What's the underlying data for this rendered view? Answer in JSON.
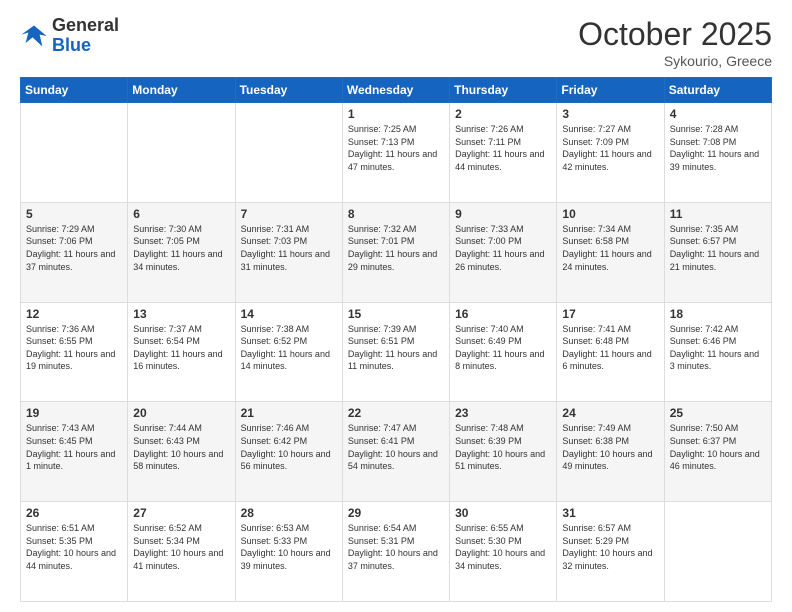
{
  "header": {
    "logo_general": "General",
    "logo_blue": "Blue",
    "month_title": "October 2025",
    "location": "Sykourio, Greece"
  },
  "days_of_week": [
    "Sunday",
    "Monday",
    "Tuesday",
    "Wednesday",
    "Thursday",
    "Friday",
    "Saturday"
  ],
  "weeks": [
    [
      {
        "day": "",
        "sunrise": "",
        "sunset": "",
        "daylight": ""
      },
      {
        "day": "",
        "sunrise": "",
        "sunset": "",
        "daylight": ""
      },
      {
        "day": "",
        "sunrise": "",
        "sunset": "",
        "daylight": ""
      },
      {
        "day": "1",
        "sunrise": "Sunrise: 7:25 AM",
        "sunset": "Sunset: 7:13 PM",
        "daylight": "Daylight: 11 hours and 47 minutes."
      },
      {
        "day": "2",
        "sunrise": "Sunrise: 7:26 AM",
        "sunset": "Sunset: 7:11 PM",
        "daylight": "Daylight: 11 hours and 44 minutes."
      },
      {
        "day": "3",
        "sunrise": "Sunrise: 7:27 AM",
        "sunset": "Sunset: 7:09 PM",
        "daylight": "Daylight: 11 hours and 42 minutes."
      },
      {
        "day": "4",
        "sunrise": "Sunrise: 7:28 AM",
        "sunset": "Sunset: 7:08 PM",
        "daylight": "Daylight: 11 hours and 39 minutes."
      }
    ],
    [
      {
        "day": "5",
        "sunrise": "Sunrise: 7:29 AM",
        "sunset": "Sunset: 7:06 PM",
        "daylight": "Daylight: 11 hours and 37 minutes."
      },
      {
        "day": "6",
        "sunrise": "Sunrise: 7:30 AM",
        "sunset": "Sunset: 7:05 PM",
        "daylight": "Daylight: 11 hours and 34 minutes."
      },
      {
        "day": "7",
        "sunrise": "Sunrise: 7:31 AM",
        "sunset": "Sunset: 7:03 PM",
        "daylight": "Daylight: 11 hours and 31 minutes."
      },
      {
        "day": "8",
        "sunrise": "Sunrise: 7:32 AM",
        "sunset": "Sunset: 7:01 PM",
        "daylight": "Daylight: 11 hours and 29 minutes."
      },
      {
        "day": "9",
        "sunrise": "Sunrise: 7:33 AM",
        "sunset": "Sunset: 7:00 PM",
        "daylight": "Daylight: 11 hours and 26 minutes."
      },
      {
        "day": "10",
        "sunrise": "Sunrise: 7:34 AM",
        "sunset": "Sunset: 6:58 PM",
        "daylight": "Daylight: 11 hours and 24 minutes."
      },
      {
        "day": "11",
        "sunrise": "Sunrise: 7:35 AM",
        "sunset": "Sunset: 6:57 PM",
        "daylight": "Daylight: 11 hours and 21 minutes."
      }
    ],
    [
      {
        "day": "12",
        "sunrise": "Sunrise: 7:36 AM",
        "sunset": "Sunset: 6:55 PM",
        "daylight": "Daylight: 11 hours and 19 minutes."
      },
      {
        "day": "13",
        "sunrise": "Sunrise: 7:37 AM",
        "sunset": "Sunset: 6:54 PM",
        "daylight": "Daylight: 11 hours and 16 minutes."
      },
      {
        "day": "14",
        "sunrise": "Sunrise: 7:38 AM",
        "sunset": "Sunset: 6:52 PM",
        "daylight": "Daylight: 11 hours and 14 minutes."
      },
      {
        "day": "15",
        "sunrise": "Sunrise: 7:39 AM",
        "sunset": "Sunset: 6:51 PM",
        "daylight": "Daylight: 11 hours and 11 minutes."
      },
      {
        "day": "16",
        "sunrise": "Sunrise: 7:40 AM",
        "sunset": "Sunset: 6:49 PM",
        "daylight": "Daylight: 11 hours and 8 minutes."
      },
      {
        "day": "17",
        "sunrise": "Sunrise: 7:41 AM",
        "sunset": "Sunset: 6:48 PM",
        "daylight": "Daylight: 11 hours and 6 minutes."
      },
      {
        "day": "18",
        "sunrise": "Sunrise: 7:42 AM",
        "sunset": "Sunset: 6:46 PM",
        "daylight": "Daylight: 11 hours and 3 minutes."
      }
    ],
    [
      {
        "day": "19",
        "sunrise": "Sunrise: 7:43 AM",
        "sunset": "Sunset: 6:45 PM",
        "daylight": "Daylight: 11 hours and 1 minute."
      },
      {
        "day": "20",
        "sunrise": "Sunrise: 7:44 AM",
        "sunset": "Sunset: 6:43 PM",
        "daylight": "Daylight: 10 hours and 58 minutes."
      },
      {
        "day": "21",
        "sunrise": "Sunrise: 7:46 AM",
        "sunset": "Sunset: 6:42 PM",
        "daylight": "Daylight: 10 hours and 56 minutes."
      },
      {
        "day": "22",
        "sunrise": "Sunrise: 7:47 AM",
        "sunset": "Sunset: 6:41 PM",
        "daylight": "Daylight: 10 hours and 54 minutes."
      },
      {
        "day": "23",
        "sunrise": "Sunrise: 7:48 AM",
        "sunset": "Sunset: 6:39 PM",
        "daylight": "Daylight: 10 hours and 51 minutes."
      },
      {
        "day": "24",
        "sunrise": "Sunrise: 7:49 AM",
        "sunset": "Sunset: 6:38 PM",
        "daylight": "Daylight: 10 hours and 49 minutes."
      },
      {
        "day": "25",
        "sunrise": "Sunrise: 7:50 AM",
        "sunset": "Sunset: 6:37 PM",
        "daylight": "Daylight: 10 hours and 46 minutes."
      }
    ],
    [
      {
        "day": "26",
        "sunrise": "Sunrise: 6:51 AM",
        "sunset": "Sunset: 5:35 PM",
        "daylight": "Daylight: 10 hours and 44 minutes."
      },
      {
        "day": "27",
        "sunrise": "Sunrise: 6:52 AM",
        "sunset": "Sunset: 5:34 PM",
        "daylight": "Daylight: 10 hours and 41 minutes."
      },
      {
        "day": "28",
        "sunrise": "Sunrise: 6:53 AM",
        "sunset": "Sunset: 5:33 PM",
        "daylight": "Daylight: 10 hours and 39 minutes."
      },
      {
        "day": "29",
        "sunrise": "Sunrise: 6:54 AM",
        "sunset": "Sunset: 5:31 PM",
        "daylight": "Daylight: 10 hours and 37 minutes."
      },
      {
        "day": "30",
        "sunrise": "Sunrise: 6:55 AM",
        "sunset": "Sunset: 5:30 PM",
        "daylight": "Daylight: 10 hours and 34 minutes."
      },
      {
        "day": "31",
        "sunrise": "Sunrise: 6:57 AM",
        "sunset": "Sunset: 5:29 PM",
        "daylight": "Daylight: 10 hours and 32 minutes."
      },
      {
        "day": "",
        "sunrise": "",
        "sunset": "",
        "daylight": ""
      }
    ]
  ]
}
